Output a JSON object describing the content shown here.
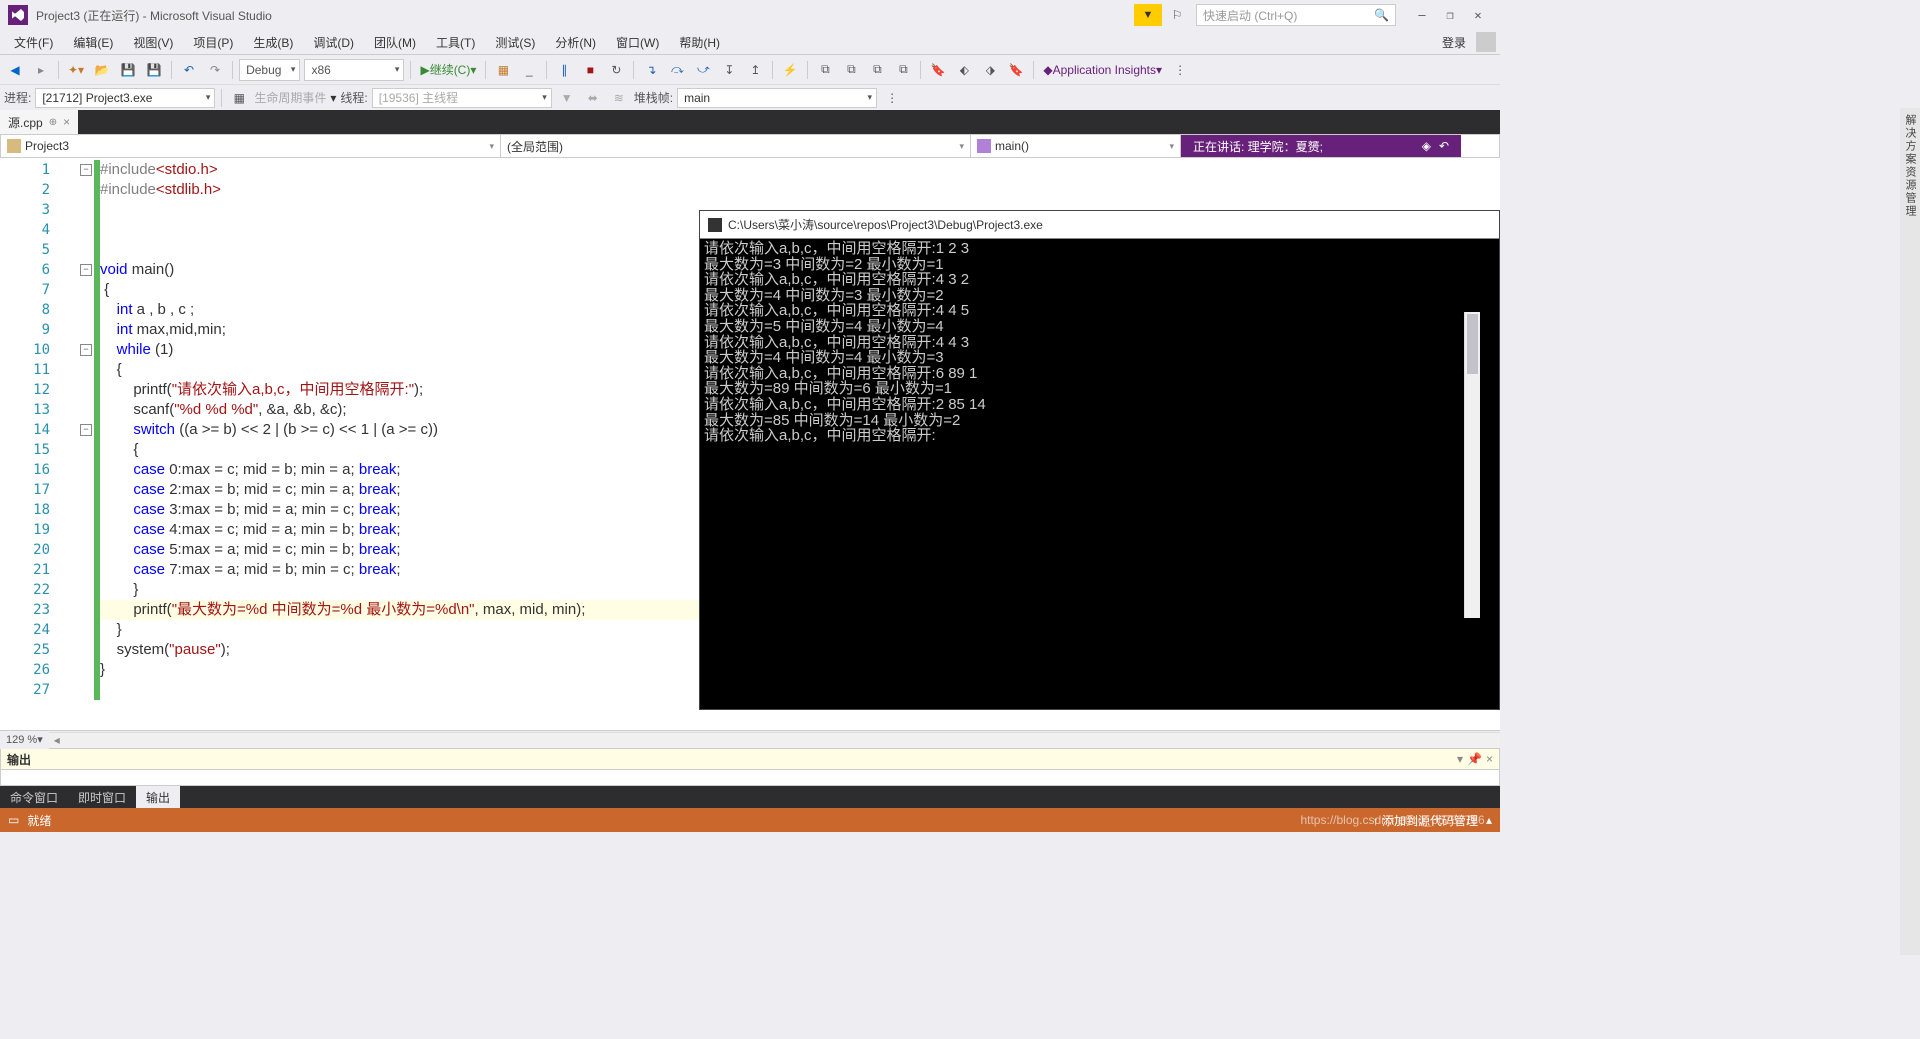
{
  "titlebar": {
    "title": "Project3 (正在运行) - Microsoft Visual Studio",
    "search_placeholder": "快速启动 (Ctrl+Q)"
  },
  "menubar": {
    "items": [
      "文件(F)",
      "编辑(E)",
      "视图(V)",
      "项目(P)",
      "生成(B)",
      "调试(D)",
      "团队(M)",
      "工具(T)",
      "测试(S)",
      "分析(N)",
      "窗口(W)",
      "帮助(H)"
    ],
    "login": "登录"
  },
  "toolbar": {
    "config": "Debug",
    "platform": "x86",
    "continue": "继续(C)",
    "insights": "Application Insights"
  },
  "toolbar2": {
    "process_label": "进程:",
    "process_value": "[21712] Project3.exe",
    "lifecycle": "生命周期事件",
    "thread_label": "线程:",
    "thread_value": "[19536] 主线程",
    "stackframe_label": "堆栈帧:",
    "stackframe_value": "main"
  },
  "tab": {
    "name": "源.cpp"
  },
  "navbar": {
    "project": "Project3",
    "scope": "(全局范围)",
    "member": "main()"
  },
  "liveshare": {
    "text": "正在讲话: 理学院：夏赟;"
  },
  "code": {
    "lines": [
      {
        "n": 1,
        "html": "<span class='inc'>#include</span><span class='incf'>&lt;stdio.h&gt;</span>",
        "fold": "box"
      },
      {
        "n": 2,
        "html": "<span class='inc'>#include</span><span class='incf'>&lt;stdlib.h&gt;</span>"
      },
      {
        "n": 3,
        "html": ""
      },
      {
        "n": 4,
        "html": ""
      },
      {
        "n": 5,
        "html": ""
      },
      {
        "n": 6,
        "html": "<span class='kw'>void</span> main()",
        "fold": "box"
      },
      {
        "n": 7,
        "html": " {"
      },
      {
        "n": 8,
        "html": "    <span class='kw'>int</span> a , b , c ;"
      },
      {
        "n": 9,
        "html": "    <span class='kw'>int</span> max,mid,min;"
      },
      {
        "n": 10,
        "html": "    <span class='kw'>while</span> (1)",
        "fold": "box"
      },
      {
        "n": 11,
        "html": "    {"
      },
      {
        "n": 12,
        "html": "        printf(<span class='str'>\"请依次输入a,b,c，中间用空格隔开:\"</span>);"
      },
      {
        "n": 13,
        "html": "        scanf(<span class='str'>\"%d %d %d\"</span>, &a, &b, &c);"
      },
      {
        "n": 14,
        "html": "        <span class='kw'>switch</span> ((a &gt;= b) &lt;&lt; 2 | (b &gt;= c) &lt;&lt; 1 | (a &gt;= c))",
        "fold": "box"
      },
      {
        "n": 15,
        "html": "        {"
      },
      {
        "n": 16,
        "html": "        <span class='kw'>case</span> 0:max = c; mid = b; min = a; <span class='kw'>break</span>;"
      },
      {
        "n": 17,
        "html": "        <span class='kw'>case</span> 2:max = b; mid = c; min = a; <span class='kw'>break</span>;"
      },
      {
        "n": 18,
        "html": "        <span class='kw'>case</span> 3:max = b; mid = a; min = c; <span class='kw'>break</span>;"
      },
      {
        "n": 19,
        "html": "        <span class='kw'>case</span> 4:max = c; mid = a; min = b; <span class='kw'>break</span>;"
      },
      {
        "n": 20,
        "html": "        <span class='kw'>case</span> 5:max = a; mid = c; min = b; <span class='kw'>break</span>;"
      },
      {
        "n": 21,
        "html": "        <span class='kw'>case</span> 7:max = a; mid = b; min = c; <span class='kw'>break</span>;"
      },
      {
        "n": 22,
        "html": "        }"
      },
      {
        "n": 23,
        "html": "        printf(<span class='str'>\"最大数为=%d 中间数为=%d 最小数为=%d\\n\"</span>, max, mid, min);",
        "hl": true
      },
      {
        "n": 24,
        "html": "    }"
      },
      {
        "n": 25,
        "html": "    system(<span class='str'>\"pause\"</span>);"
      },
      {
        "n": 26,
        "html": "}"
      },
      {
        "n": 27,
        "html": ""
      }
    ]
  },
  "console": {
    "title": "C:\\Users\\菜小涛\\source\\repos\\Project3\\Debug\\Project3.exe",
    "lines": [
      "请依次输入a,b,c，中间用空格隔开:1 2 3",
      "最大数为=3 中间数为=2 最小数为=1",
      "请依次输入a,b,c，中间用空格隔开:4 3 2",
      "最大数为=4 中间数为=3 最小数为=2",
      "请依次输入a,b,c，中间用空格隔开:4 4 5",
      "最大数为=5 中间数为=4 最小数为=4",
      "请依次输入a,b,c，中间用空格隔开:4 4 3",
      "最大数为=4 中间数为=4 最小数为=3",
      "请依次输入a,b,c，中间用空格隔开:6 89 1",
      "最大数为=89 中间数为=6 最小数为=1",
      "请依次输入a,b,c，中间用空格隔开:2 85 14",
      "最大数为=85 中间数为=14 最小数为=2",
      "请依次输入a,b,c，中间用空格隔开:"
    ]
  },
  "zoom": "129 %",
  "output": {
    "title": "输出"
  },
  "bottom_tabs": {
    "items": [
      "命令窗口",
      "即时窗口",
      "输出"
    ],
    "active": 2
  },
  "statusbar": {
    "ready": "就绪",
    "scm": "↑ 添加到源代码管理",
    "watermark": "https://blog.csdn.net/qq_36757786"
  },
  "right_rail": "解决方案资源管理"
}
